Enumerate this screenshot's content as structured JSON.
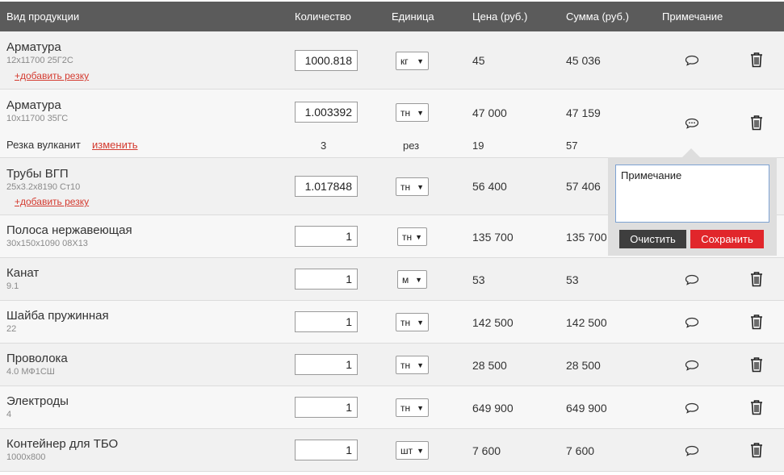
{
  "headers": {
    "product": "Вид продукции",
    "quantity": "Количество",
    "unit": "Единица",
    "price": "Цена (руб.)",
    "sum": "Сумма (руб.)",
    "note": "Примечание"
  },
  "add_cut_label": "+добавить резку",
  "rows": [
    {
      "name": "Арматура",
      "spec": "12х11700 25Г2С",
      "qty": "1000.818",
      "unit": "кг",
      "price": "45",
      "sum": "45 036"
    },
    {
      "name": "Арматура",
      "spec": "10х11700 35ГС",
      "qty": "1.003392",
      "unit": "тн",
      "price": "47 000",
      "sum": "47 159"
    },
    {
      "name": "Трубы ВГП",
      "spec": "25х3.2х8190 Ст10",
      "qty": "1.017848",
      "unit": "тн",
      "price": "56 400",
      "sum": "57 406"
    },
    {
      "name": "Полоса нержавеющая",
      "spec": "30х150х1090 08Х13",
      "qty": "1",
      "unit": "тн",
      "price": "135 700",
      "sum": "135 700"
    },
    {
      "name": "Канат",
      "spec": "9.1",
      "qty": "1",
      "unit": "м",
      "price": "53",
      "sum": "53"
    },
    {
      "name": "Шайба пружинная",
      "spec": "22",
      "qty": "1",
      "unit": "тн",
      "price": "142 500",
      "sum": "142 500"
    },
    {
      "name": "Проволока",
      "spec": "4.0 МФ1СШ",
      "qty": "1",
      "unit": "тн",
      "price": "28 500",
      "sum": "28 500"
    },
    {
      "name": "Электроды",
      "spec": "4",
      "qty": "1",
      "unit": "тн",
      "price": "649 900",
      "sum": "649 900"
    },
    {
      "name": "Контейнер для ТБО",
      "spec": "1000х800",
      "qty": "1",
      "unit": "шт",
      "price": "7 600",
      "sum": "7 600"
    }
  ],
  "cut_line": {
    "label": "Резка вулканит",
    "edit_label": "изменить",
    "qty": "3",
    "unit": "рез",
    "price": "19",
    "sum": "57"
  },
  "note_popup": {
    "value": "Примечание",
    "clear_label": "Очистить",
    "save_label": "Сохранить"
  },
  "colors": {
    "header_bg": "#5b5b5b",
    "link": "#d43a2f",
    "save_button": "#e1262b",
    "clear_button": "#3e3e3e"
  },
  "icons": {
    "note": "speech-bubble-icon",
    "delete": "trash-icon",
    "dropdown": "caret-down-icon"
  }
}
